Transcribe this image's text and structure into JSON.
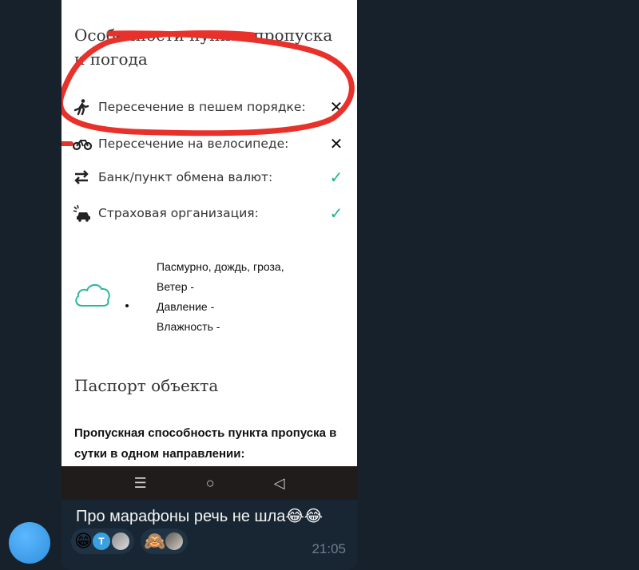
{
  "screenshot": {
    "weather_section_title": "Особенности пункта пропуска и погода",
    "features": [
      {
        "icon": "pedestrian-icon",
        "label": "Пересечение в пешем порядке:",
        "status": "no",
        "mark": "✕"
      },
      {
        "icon": "bicycle-icon",
        "label": "Пересечение на велосипеде:",
        "status": "no",
        "mark": "✕"
      },
      {
        "icon": "exchange-icon",
        "label": "Банк/пункт обмена валют:",
        "status": "yes",
        "mark": "✓"
      },
      {
        "icon": "car-crash-icon",
        "label": "Страховая организация:",
        "status": "yes",
        "mark": "✓"
      }
    ],
    "weather": {
      "icon": "cloud-icon",
      "condition": "Пасмурно, дождь, гроза,",
      "wind": "Ветер -",
      "pressure": "Давление -",
      "humidity": "Влажность -"
    },
    "passport_title": "Паспорт объекта",
    "capacity_text": "Пропускная способность пункта пропуска в сутки в одном направлении:",
    "navbar": {
      "menu": "☰",
      "home": "○",
      "back": "◁"
    }
  },
  "message": {
    "text": "Про марафоны речь не шла😂😂",
    "time": "21:05",
    "reactions": [
      {
        "emoji": "😁",
        "users": [
          "Т",
          "photo"
        ]
      },
      {
        "emoji": "🙈",
        "users": [
          "photo"
        ]
      }
    ]
  },
  "colors": {
    "background": "#17212b",
    "bubble": "#182533",
    "check": "#1ab394",
    "annotation": "#e8312a",
    "avatar": "#3aa0e0"
  }
}
